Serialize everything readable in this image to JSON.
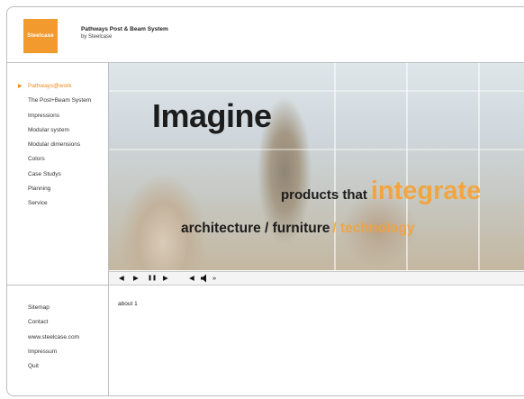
{
  "header": {
    "logo_text": "Steelcase",
    "title": "Pathways Post & Beam System",
    "subtitle": "by Steelcase",
    "accent_color": "#f39a2e"
  },
  "nav": {
    "items": [
      {
        "label": "Pathways@work",
        "active": true
      },
      {
        "label": "The Post+Beam System"
      },
      {
        "label": "Impressions"
      },
      {
        "label": "Modular system"
      },
      {
        "label": "Modular dimensions"
      },
      {
        "label": "Colors"
      },
      {
        "label": "Case Studys"
      },
      {
        "label": "Planning"
      },
      {
        "label": "Service"
      }
    ]
  },
  "hero": {
    "title": "Imagine",
    "line1_dark": "products that",
    "line1_orange": "integrate",
    "line2_dark": "architecture / furniture",
    "line2_orange": "/ technology"
  },
  "controls": {
    "rewind": "◀",
    "play": "▶",
    "pause": "❚❚",
    "forward": "▶",
    "volume_down": "◀",
    "speaker": "speaker-icon",
    "volume_up": "»"
  },
  "footer_nav": {
    "items": [
      "Sitemap",
      "Contact",
      "www.steelcase.com",
      "Impressum",
      "Quit"
    ]
  },
  "content": {
    "text": "about 1"
  }
}
